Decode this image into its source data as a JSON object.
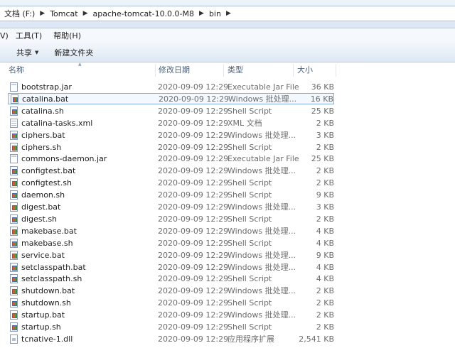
{
  "address": {
    "segments": [
      "文档 (F:)",
      "Tomcat",
      "apache-tomcat-10.0.0-M8",
      "bin"
    ]
  },
  "menu": [
    "V)",
    "工具(T)",
    "帮助(H)"
  ],
  "toolbar": {
    "share_label": "共享",
    "new_folder_label": "新建文件夹"
  },
  "columns": {
    "name": "名称",
    "date": "修改日期",
    "type": "类型",
    "size": "大小"
  },
  "files": [
    {
      "name": "bootstrap.jar",
      "date": "2020-09-09 12:29",
      "type": "Executable Jar File",
      "size": "36 KB",
      "icon": "jar"
    },
    {
      "name": "catalina.bat",
      "date": "2020-09-09 12:29",
      "type": "Windows 批处理...",
      "size": "16 KB",
      "icon": "win",
      "selected": true
    },
    {
      "name": "catalina.sh",
      "date": "2020-09-09 12:29",
      "type": "Shell Script",
      "size": "25 KB",
      "icon": "win"
    },
    {
      "name": "catalina-tasks.xml",
      "date": "2020-09-09 12:29",
      "type": "XML 文档",
      "size": "2 KB",
      "icon": "xml"
    },
    {
      "name": "ciphers.bat",
      "date": "2020-09-09 12:29",
      "type": "Windows 批处理...",
      "size": "3 KB",
      "icon": "win"
    },
    {
      "name": "ciphers.sh",
      "date": "2020-09-09 12:29",
      "type": "Shell Script",
      "size": "2 KB",
      "icon": "win"
    },
    {
      "name": "commons-daemon.jar",
      "date": "2020-09-09 12:29",
      "type": "Executable Jar File",
      "size": "25 KB",
      "icon": "jar"
    },
    {
      "name": "configtest.bat",
      "date": "2020-09-09 12:29",
      "type": "Windows 批处理...",
      "size": "2 KB",
      "icon": "win"
    },
    {
      "name": "configtest.sh",
      "date": "2020-09-09 12:29",
      "type": "Shell Script",
      "size": "2 KB",
      "icon": "win"
    },
    {
      "name": "daemon.sh",
      "date": "2020-09-09 12:29",
      "type": "Shell Script",
      "size": "9 KB",
      "icon": "win"
    },
    {
      "name": "digest.bat",
      "date": "2020-09-09 12:29",
      "type": "Windows 批处理...",
      "size": "3 KB",
      "icon": "win"
    },
    {
      "name": "digest.sh",
      "date": "2020-09-09 12:29",
      "type": "Shell Script",
      "size": "2 KB",
      "icon": "win"
    },
    {
      "name": "makebase.bat",
      "date": "2020-09-09 12:29",
      "type": "Windows 批处理...",
      "size": "4 KB",
      "icon": "win"
    },
    {
      "name": "makebase.sh",
      "date": "2020-09-09 12:29",
      "type": "Shell Script",
      "size": "4 KB",
      "icon": "win"
    },
    {
      "name": "service.bat",
      "date": "2020-09-09 12:29",
      "type": "Windows 批处理...",
      "size": "9 KB",
      "icon": "win"
    },
    {
      "name": "setclasspath.bat",
      "date": "2020-09-09 12:29",
      "type": "Windows 批处理...",
      "size": "4 KB",
      "icon": "win"
    },
    {
      "name": "setclasspath.sh",
      "date": "2020-09-09 12:29",
      "type": "Shell Script",
      "size": "4 KB",
      "icon": "win"
    },
    {
      "name": "shutdown.bat",
      "date": "2020-09-09 12:29",
      "type": "Windows 批处理...",
      "size": "2 KB",
      "icon": "win"
    },
    {
      "name": "shutdown.sh",
      "date": "2020-09-09 12:29",
      "type": "Shell Script",
      "size": "2 KB",
      "icon": "win"
    },
    {
      "name": "startup.bat",
      "date": "2020-09-09 12:29",
      "type": "Windows 批处理...",
      "size": "2 KB",
      "icon": "win"
    },
    {
      "name": "startup.sh",
      "date": "2020-09-09 12:29",
      "type": "Shell Script",
      "size": "2 KB",
      "icon": "win"
    },
    {
      "name": "tcnative-1.dll",
      "date": "2020-09-09 12:29",
      "type": "应用程序扩展",
      "size": "2,541 KB",
      "icon": "dll"
    }
  ]
}
